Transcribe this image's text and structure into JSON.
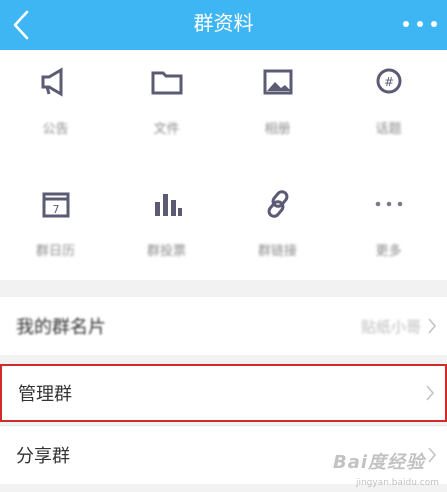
{
  "header": {
    "title": "群资料",
    "bg_color": "#3fb6f4",
    "back_icon": "back-chevron-icon",
    "more_icon": "more-dots-icon"
  },
  "features": [
    {
      "label": "公告",
      "icon": "megaphone-icon"
    },
    {
      "label": "文件",
      "icon": "folder-icon"
    },
    {
      "label": "相册",
      "icon": "photo-album-icon"
    },
    {
      "label": "话题",
      "icon": "topic-icon"
    },
    {
      "label": "群日历",
      "icon": "calendar-icon"
    },
    {
      "label": "群投票",
      "icon": "bar-chart-icon"
    },
    {
      "label": "群链接",
      "icon": "link-icon"
    },
    {
      "label": "更多",
      "icon": "more-horizontal-icon"
    }
  ],
  "rows": {
    "card": {
      "label": "我的群名片",
      "value": "贴纸小哥"
    },
    "manage": {
      "label": "管理群"
    },
    "share": {
      "label": "分享群"
    }
  },
  "watermark": {
    "main": "Bai度经验",
    "sub": "jingyan.baidu.com"
  }
}
